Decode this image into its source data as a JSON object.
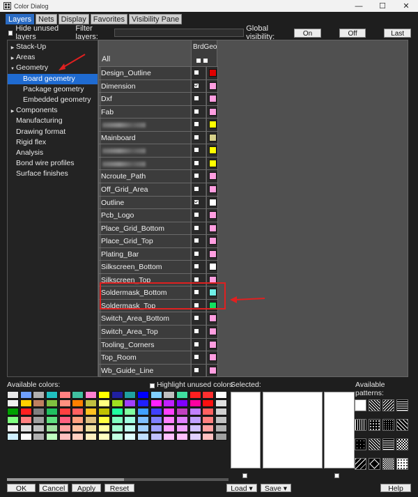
{
  "window": {
    "title": "Color Dialog",
    "controls": [
      "—",
      "☐",
      "✕"
    ]
  },
  "tabs": [
    {
      "label": "Layers",
      "active": true
    },
    {
      "label": "Nets",
      "active": false
    },
    {
      "label": "Display",
      "active": false
    },
    {
      "label": "Favorites",
      "active": false
    },
    {
      "label": "Visibility Pane",
      "active": false
    }
  ],
  "toolbar": {
    "hide_unused_label": "Hide unused layers",
    "filter_label": "Filter layers:",
    "filter_value": "",
    "global_visibility_label": "Global visibility:",
    "on_label": "On",
    "off_label": "Off",
    "last_label": "Last"
  },
  "tree": [
    {
      "label": "Stack-Up",
      "arrow": "▶",
      "indent": 0,
      "selected": false
    },
    {
      "label": "Areas",
      "arrow": "▶",
      "indent": 0,
      "selected": false
    },
    {
      "label": "Geometry",
      "arrow": "▼",
      "indent": 0,
      "selected": false
    },
    {
      "label": "Board geometry",
      "arrow": "",
      "indent": 1,
      "selected": true
    },
    {
      "label": "Package geometry",
      "arrow": "",
      "indent": 1,
      "selected": false
    },
    {
      "label": "Embedded geometry",
      "arrow": "",
      "indent": 1,
      "selected": false
    },
    {
      "label": "Components",
      "arrow": "▶",
      "indent": 0,
      "selected": false
    },
    {
      "label": "Manufacturing",
      "arrow": "",
      "indent": 0,
      "selected": false
    },
    {
      "label": "Drawing format",
      "arrow": "",
      "indent": 0,
      "selected": false
    },
    {
      "label": "Rigid flex",
      "arrow": "",
      "indent": 0,
      "selected": false
    },
    {
      "label": "Analysis",
      "arrow": "",
      "indent": 0,
      "selected": false
    },
    {
      "label": "Bond wire profiles",
      "arrow": "",
      "indent": 0,
      "selected": false
    },
    {
      "label": "Surface finishes",
      "arrow": "",
      "indent": 0,
      "selected": false
    }
  ],
  "grid": {
    "column_header": "BrdGeo",
    "all_label": "All",
    "rows": [
      {
        "name": "Design_Outline",
        "checked": false,
        "color": "#e00000",
        "blurred": false
      },
      {
        "name": "Dimension",
        "checked": true,
        "color": "#ff9ee0",
        "blurred": false
      },
      {
        "name": "Dxf",
        "checked": false,
        "color": "#ff9ee0",
        "blurred": false
      },
      {
        "name": "Fab",
        "checked": false,
        "color": "#ff9ee0",
        "blurred": false
      },
      {
        "name": "",
        "checked": false,
        "color": "#ffff00",
        "blurred": true
      },
      {
        "name": "Mainboard",
        "checked": false,
        "color": "#d6d08a",
        "blurred": false
      },
      {
        "name": "",
        "checked": false,
        "color": "#ffff00",
        "blurred": true
      },
      {
        "name": "",
        "checked": false,
        "color": "#ffff00",
        "blurred": true
      },
      {
        "name": "Ncroute_Path",
        "checked": false,
        "color": "#ff9ee0",
        "blurred": false
      },
      {
        "name": "Off_Grid_Area",
        "checked": false,
        "color": "#ff9ee0",
        "blurred": false
      },
      {
        "name": "Outline",
        "checked": true,
        "color": "#ffffff",
        "blurred": false
      },
      {
        "name": "Pcb_Logo",
        "checked": false,
        "color": "#ff9ee0",
        "blurred": false
      },
      {
        "name": "Place_Grid_Bottom",
        "checked": false,
        "color": "#ff9ee0",
        "blurred": false
      },
      {
        "name": "Place_Grid_Top",
        "checked": false,
        "color": "#ff9ee0",
        "blurred": false
      },
      {
        "name": "Plating_Bar",
        "checked": false,
        "color": "#ff9ee0",
        "blurred": false
      },
      {
        "name": "Silkscreen_Bottom",
        "checked": false,
        "color": "#ffffff",
        "blurred": false
      },
      {
        "name": "Silkscreen_Top",
        "checked": false,
        "color": "#ff9ee0",
        "blurred": false
      },
      {
        "name": "Soldermask_Bottom",
        "checked": false,
        "color": "#6ff0e8",
        "blurred": false
      },
      {
        "name": "Soldermask_Top",
        "checked": false,
        "color": "#12e060",
        "blurred": false
      },
      {
        "name": "Switch_Area_Bottom",
        "checked": false,
        "color": "#ff9ee0",
        "blurred": false
      },
      {
        "name": "Switch_Area_Top",
        "checked": false,
        "color": "#ff9ee0",
        "blurred": false
      },
      {
        "name": "Tooling_Corners",
        "checked": false,
        "color": "#ff9ee0",
        "blurred": false
      },
      {
        "name": "Top_Room",
        "checked": false,
        "color": "#ff9ee0",
        "blurred": false
      },
      {
        "name": "Wb_Guide_Line",
        "checked": false,
        "color": "#ff9ee0",
        "blurred": false
      }
    ]
  },
  "colors_panel": {
    "available_colors_label": "Available colors:",
    "highlight_unused_label": "Highlight unused colors",
    "selected_label": "Selected:",
    "available_patterns_label": "Available patterns:",
    "palette": [
      [
        "#e8e8e8",
        "#6fa0ff",
        "#b0b0b0",
        "#20c0c0",
        "#ff8080",
        "#40c0a0",
        "#ff80d0",
        "#ffff00",
        "#2020a0",
        "#20a0a0",
        "#0000ff",
        "#80d0ff",
        "#c0c0c0",
        "#40e0a0",
        "#ff2020",
        "#ff3030",
        "#ffffff"
      ],
      [
        "#f0f0f0",
        "#ffd000",
        "#c08060",
        "#80c040",
        "#ff9080",
        "#ff8000",
        "#c0c040",
        "#ffff80",
        "#a0e020",
        "#a040ff",
        "#2020ff",
        "#ff20ff",
        "#c020ff",
        "#8000ff",
        "#ff00a0",
        "#ff1010",
        "#e0e0e0"
      ],
      [
        "#00a000",
        "#ff2020",
        "#808080",
        "#20c060",
        "#ff4040",
        "#ff6060",
        "#ffc020",
        "#c0c000",
        "#20ffa0",
        "#80ffa0",
        "#40a0ff",
        "#4040ff",
        "#ff40ff",
        "#c040c0",
        "#c080ff",
        "#ff6060",
        "#d0d0d0"
      ],
      [
        "#80ff80",
        "#ff8080",
        "#a0a0a0",
        "#60e080",
        "#ff6080",
        "#ffa080",
        "#e0c080",
        "#ffff40",
        "#80ffc0",
        "#a0ffe0",
        "#80c0ff",
        "#8080ff",
        "#ff80ff",
        "#e080ff",
        "#c0a0ff",
        "#ff8080",
        "#c0c0c0"
      ],
      [
        "#f0f0f0",
        "#e0e0e0",
        "#c0c0c0",
        "#a0e0a0",
        "#ffa0a0",
        "#ffc0a0",
        "#f0e0a0",
        "#ffffa0",
        "#a0ffd0",
        "#c0fff0",
        "#a0d0ff",
        "#a0a0ff",
        "#ffa0ff",
        "#f0a0ff",
        "#d0c0ff",
        "#ffa0a0",
        "#b0b0b0"
      ],
      [
        "#d0f0ff",
        "#ffffff",
        "#b0b0b0",
        "#c0ffc0",
        "#ffc0c0",
        "#ffd0c0",
        "#fff0c0",
        "#ffffc0",
        "#c0ffe0",
        "#e0ffff",
        "#c0e0ff",
        "#c0c0ff",
        "#ffc0ff",
        "#ffc0ff",
        "#e0d0ff",
        "#ffc0c0",
        "#a0a0a0"
      ]
    ]
  },
  "buttons": {
    "ok": "OK",
    "cancel": "Cancel",
    "apply": "Apply",
    "reset": "Reset",
    "load": "Load",
    "save": "Save",
    "help": "Help",
    "dropdown_arrow": "▾"
  },
  "accent": {
    "tab": "#2b6cc4",
    "selection": "#1f6bd1",
    "highlight": "#e02020"
  }
}
